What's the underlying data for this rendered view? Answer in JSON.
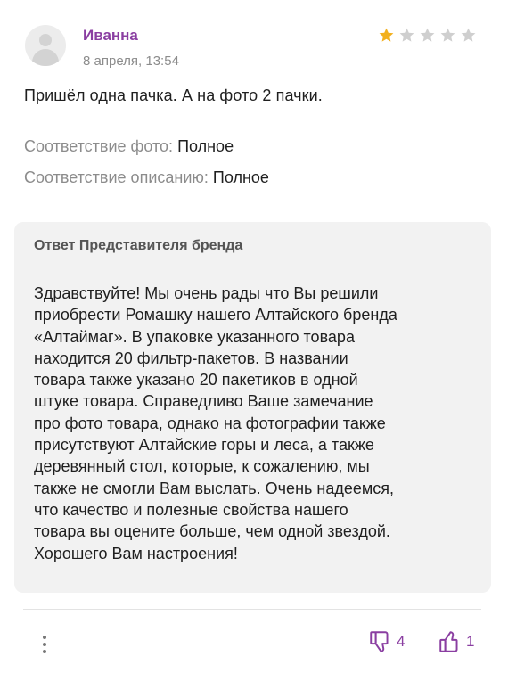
{
  "review": {
    "author": "Иванна",
    "date": "8 апреля, 13:54",
    "rating": 1,
    "rating_max": 5,
    "text": "Пришёл одна пачка. А на фото 2 пачки.",
    "photo_match_label": "Соответствие фото:",
    "photo_match_value": "Полное",
    "description_match_label": "Соответствие описанию:",
    "description_match_value": "Полное"
  },
  "reply": {
    "title": "Ответ Представителя бренда",
    "lines": [
      "Здравствуйте! Мы очень рады что Вы решили",
      "приобрести Ромашку нашего Алтайского бренда",
      "«Алтаймаг». В упаковке указанного товара",
      "находится 20 фильтр-пакетов. В названии",
      "товара также указано 20 пакетиков в одной",
      "штуке товара. Справедливо Ваше замечание",
      "про фото товара, однако на фотографии также",
      "присутствуют Алтайские горы и леса, а также",
      "деревянный стол, которые, к сожалению, мы",
      "также не смогли Вам выслать. Очень надеемся,",
      "что качество и полезные свойства нашего",
      "товара вы оцените больше, чем одной звездой.",
      "Хорошего Вам настроения!"
    ]
  },
  "actions": {
    "dislike_count": "4",
    "like_count": "1"
  },
  "icons": {
    "avatar": "user-avatar-icon",
    "star": "star-icon",
    "more": "more-vertical-icon",
    "dislike": "thumbs-down-icon",
    "like": "thumbs-up-icon"
  },
  "colors": {
    "accent": "#8a3ea1",
    "star_filled": "#f2b01e",
    "star_empty": "#cfcfcf",
    "reply_bg": "#f2f2f2",
    "muted_text": "#8c8c8c"
  }
}
